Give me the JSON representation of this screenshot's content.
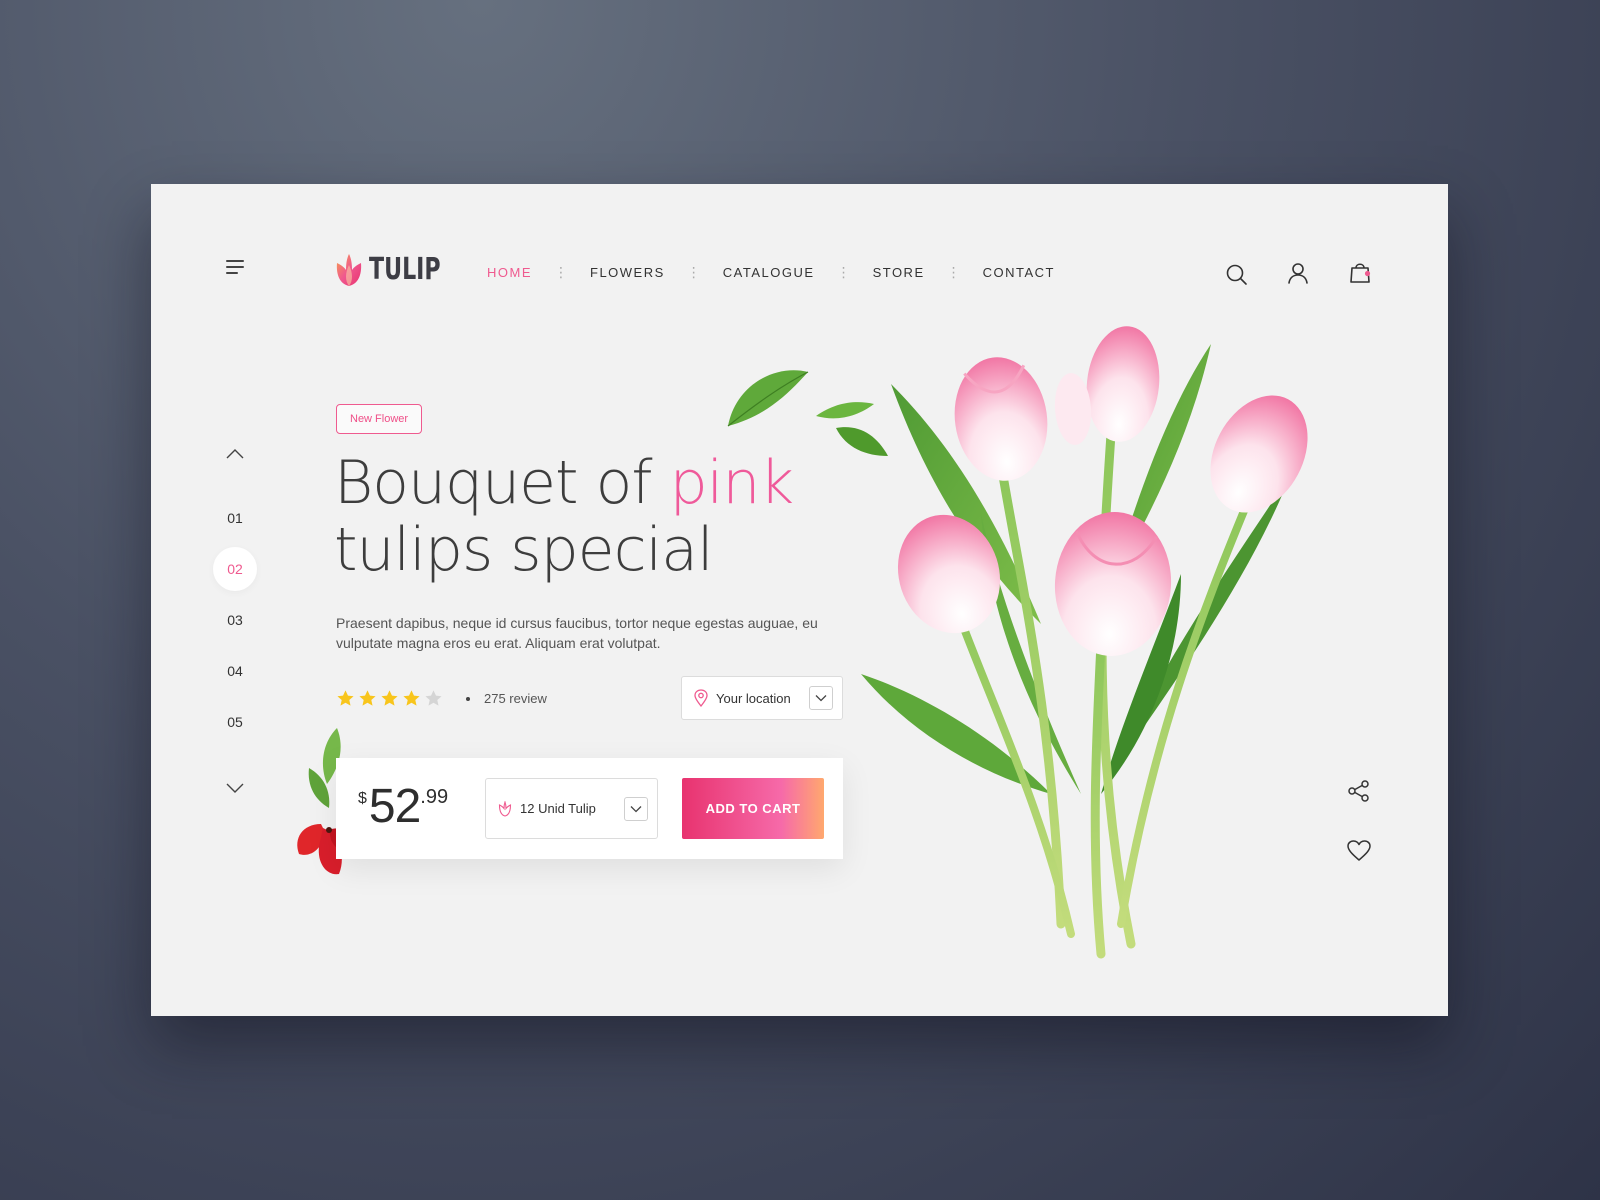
{
  "brand": {
    "name": "TULIP",
    "logo_icon": "tulip-logo-icon",
    "accent": "#ef5a8f"
  },
  "nav": {
    "items": [
      {
        "label": "HOME",
        "active": true
      },
      {
        "label": "FLOWERS",
        "active": false
      },
      {
        "label": "CATALOGUE",
        "active": false
      },
      {
        "label": "STORE",
        "active": false
      },
      {
        "label": "CONTACT",
        "active": false
      }
    ],
    "separator": "⋮"
  },
  "header_icons": [
    "search-icon",
    "user-icon",
    "shopping-bag-icon"
  ],
  "pager": {
    "pages": [
      "01",
      "02",
      "03",
      "04",
      "05"
    ],
    "active": "02"
  },
  "hero": {
    "badge": "New Flower",
    "title_part1": "Bouquet of ",
    "title_highlight": "pink",
    "title_part2": "tulips special",
    "description": "Praesent dapibus, neque id cursus faucibus, tortor neque egestas auguae, eu vulputate magna eros eu erat. Aliquam erat volutpat.",
    "rating": {
      "value": 4,
      "max": 5
    },
    "reviews": "275 review"
  },
  "location": {
    "label": "Your location"
  },
  "purchase": {
    "currency": "$",
    "price_main": "52",
    "price_cents": ".99",
    "quantity_label": "12 Unid Tulip",
    "add_to_cart": "ADD TO CART"
  },
  "side_icons": [
    "share-icon",
    "heart-icon"
  ],
  "colors": {
    "star": "#f8c51c",
    "star_empty": "#d5d5d5",
    "pink": "#ef5a9a"
  }
}
